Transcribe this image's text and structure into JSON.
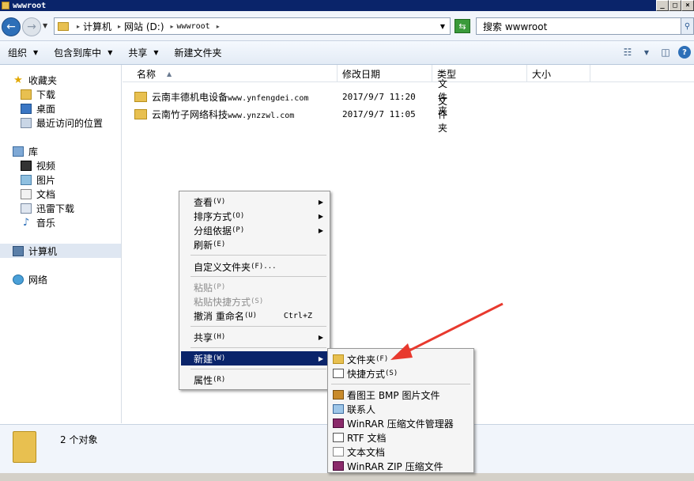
{
  "window": {
    "title": "wwwroot",
    "title_buttons": [
      "_",
      "□",
      "×"
    ]
  },
  "address": {
    "crumbs": [
      "计算机",
      "网站 (D:)",
      "wwwroot"
    ],
    "search_placeholder": "搜索 wwwroot"
  },
  "toolbar": {
    "organize": "组织",
    "include_in_library": "包含到库中",
    "share": "共享",
    "new_folder": "新建文件夹"
  },
  "sidebar": {
    "favorites": "收藏夹",
    "downloads": "下载",
    "desktop": "桌面",
    "recent": "最近访问的位置",
    "libraries": "库",
    "videos": "视频",
    "pictures": "图片",
    "documents": "文档",
    "thunder": "迅雷下载",
    "music": "音乐",
    "computer": "计算机",
    "network": "网络"
  },
  "columns": {
    "name": "名称",
    "modified": "修改日期",
    "type": "类型",
    "size": "大小"
  },
  "files": [
    {
      "name_cn": "云南丰德机电设备",
      "name_url": "www.ynfengdei.com",
      "date": "2017/9/7 11:20",
      "type": "文件夹"
    },
    {
      "name_cn": "云南竹子网络科技",
      "name_url": "www.ynzzwl.com",
      "date": "2017/9/7 11:05",
      "type": "文件夹"
    }
  ],
  "status": {
    "count": "2 个对象"
  },
  "context_menu": {
    "view": "查看",
    "view_key": "(V)",
    "sort": "排序方式",
    "sort_key": "(O)",
    "group": "分组依据",
    "group_key": "(P)",
    "refresh": "刷新",
    "refresh_key": "(E)",
    "customize": "自定义文件夹",
    "customize_key": "(F)...",
    "paste": "粘贴",
    "paste_key": "(P)",
    "paste_shortcut": "粘贴快捷方式",
    "paste_shortcut_key": "(S)",
    "undo": "撤消 重命名",
    "undo_key": "(U)",
    "undo_shortcut": "Ctrl+Z",
    "share": "共享",
    "share_key": "(H)",
    "new": "新建",
    "new_key": "(W)",
    "properties": "属性",
    "properties_key": "(R)"
  },
  "submenu": {
    "folder": "文件夹",
    "folder_key": "(F)",
    "shortcut": "快捷方式",
    "shortcut_key": "(S)",
    "bmp": "看图王 BMP 图片文件",
    "contact": "联系人",
    "winrar": "WinRAR 压缩文件管理器",
    "rtf": "RTF 文档",
    "text": "文本文档",
    "zip": "WinRAR ZIP 压缩文件"
  },
  "colors": {
    "highlight": "#0a246a",
    "arrow": "#e8392e"
  }
}
